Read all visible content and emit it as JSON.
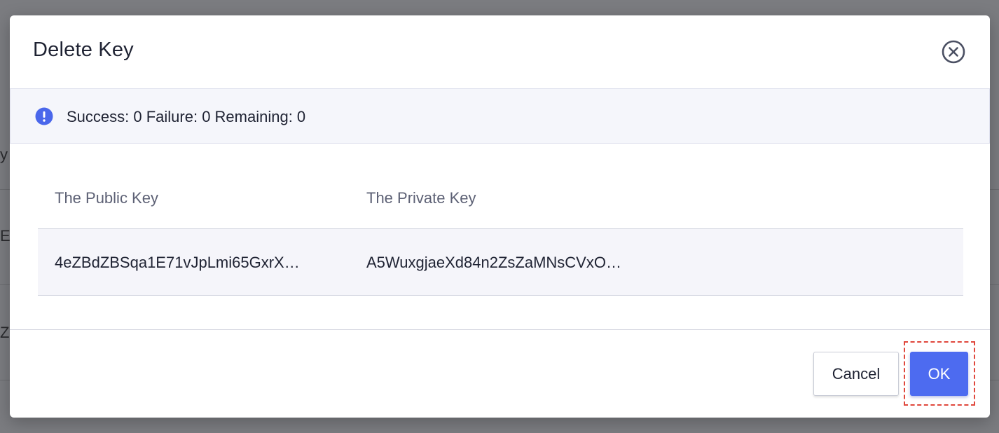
{
  "background": {
    "fragments": [
      "y",
      "E",
      "Z"
    ]
  },
  "dialog": {
    "title": "Delete Key",
    "close_icon": "close-circle-icon",
    "alert": {
      "icon": "exclamation-circle-icon",
      "text": "Success: 0 Failure: 0 Remaining: 0",
      "icon_color": "#4a67eb"
    },
    "table": {
      "columns": [
        "The Public Key",
        "The Private Key"
      ],
      "rows": [
        {
          "public_key": "4eZBdZBSqa1E71vJpLmi65GxrX…",
          "private_key": "A5WuxgjaeXd84n2ZsZaMNsCVxO…"
        }
      ]
    },
    "buttons": {
      "cancel": "Cancel",
      "ok": "OK"
    },
    "accent_color": "#4d6bf0",
    "focus_outline_color": "#e0473c"
  }
}
